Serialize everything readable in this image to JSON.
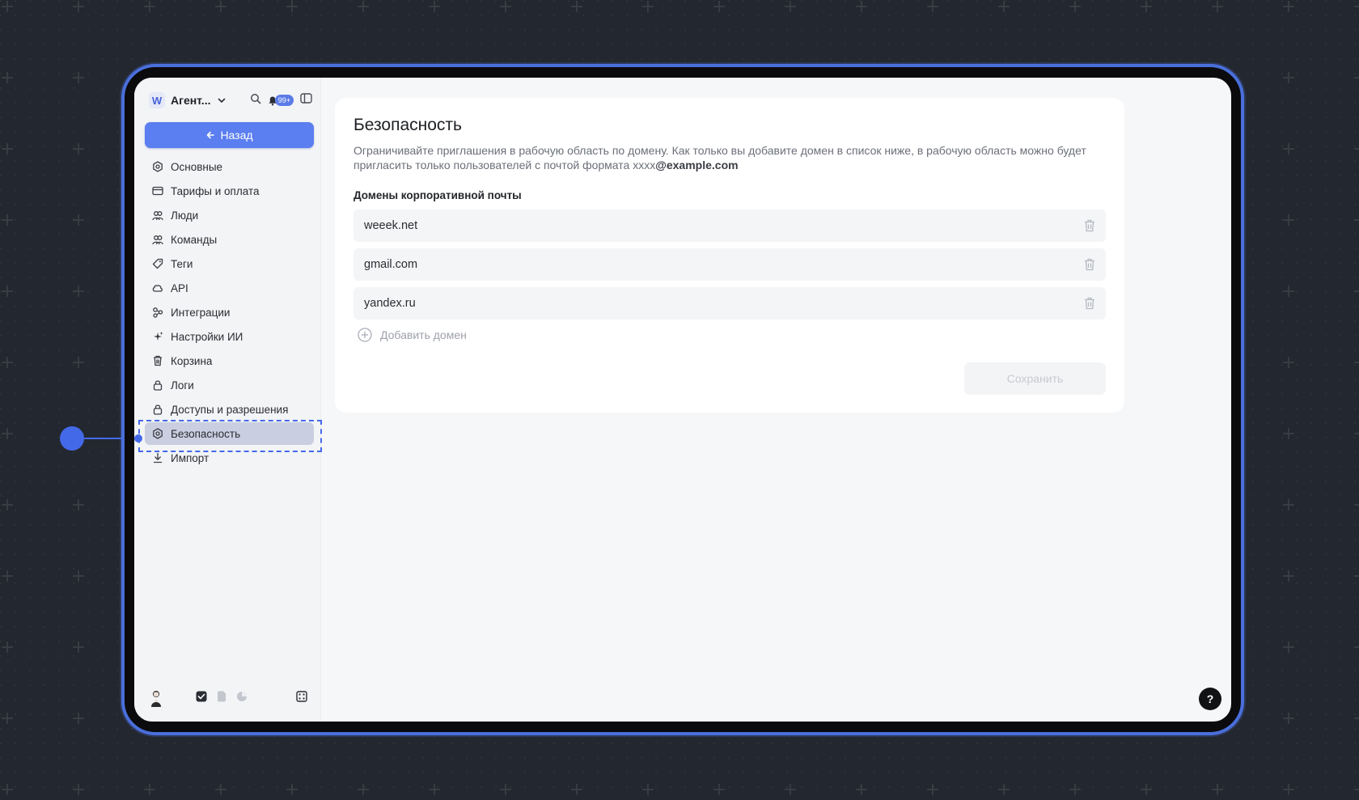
{
  "workspace": {
    "name": "Агент...",
    "logo_letter": "W",
    "notifications_badge": "99+"
  },
  "sidebar": {
    "back_label": "Назад",
    "items": [
      {
        "label": "Основные",
        "icon": "gear-icon"
      },
      {
        "label": "Тарифы и оплата",
        "icon": "card-icon"
      },
      {
        "label": "Люди",
        "icon": "people-icon"
      },
      {
        "label": "Команды",
        "icon": "people-icon"
      },
      {
        "label": "Теги",
        "icon": "tag-icon"
      },
      {
        "label": "API",
        "icon": "cloud-icon"
      },
      {
        "label": "Интеграции",
        "icon": "integrations-icon"
      },
      {
        "label": "Настройки ИИ",
        "icon": "sparkles-icon"
      },
      {
        "label": "Корзина",
        "icon": "trash-icon"
      },
      {
        "label": "Логи",
        "icon": "lock-icon"
      },
      {
        "label": "Доступы и разрешения",
        "icon": "lock-icon"
      },
      {
        "label": "Безопасность",
        "icon": "gear-icon",
        "active": true
      },
      {
        "label": "Импорт",
        "icon": "download-icon"
      }
    ]
  },
  "main": {
    "title": "Безопасность",
    "description": "Ограничивайте приглашения в рабочую область по домену. Как только вы добавите домен в список ниже, в рабочую область можно будет пригласить только пользователей с почтой формата xxxx",
    "description_bold": "@example.com",
    "section_label": "Домены корпоративной почты",
    "domains": [
      "weeek.net",
      "gmail.com",
      "yandex.ru"
    ],
    "add_domain_label": "Добавить домен",
    "save_label": "Сохранить"
  },
  "help_label": "?",
  "colors": {
    "accent": "#5b7ef0",
    "frame": "#4a6fdc",
    "annotation": "#4469e8",
    "active_item": "#c9cee0"
  }
}
